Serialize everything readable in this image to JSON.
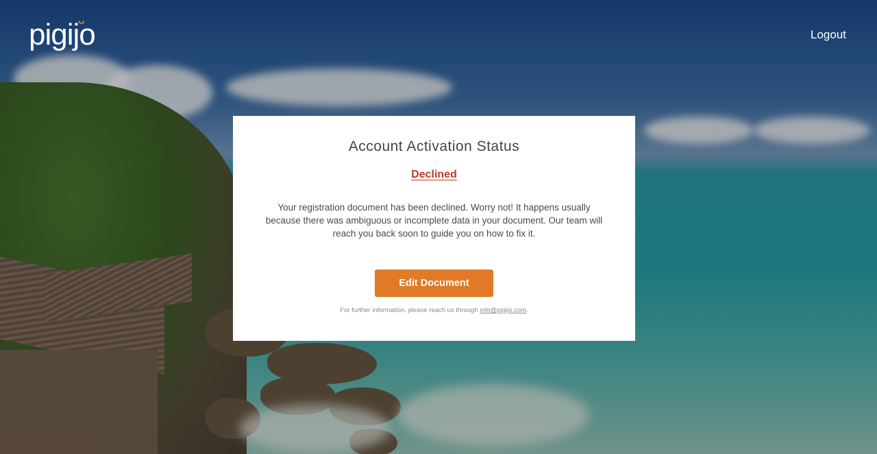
{
  "header": {
    "logo_text": "pigijo",
    "logout_label": "Logout"
  },
  "card": {
    "title": "Account Activation Status",
    "status": "Declined",
    "message": "Your registration document has been declined. Worry not! It happens usually because there was ambiguous or incomplete data in your document. Our team will reach you back soon to guide you on how to fix it.",
    "button_label": "Edit Document",
    "footer_prefix": "For further information, please reach us through ",
    "footer_email": "info@pigijo.com",
    "footer_suffix": "."
  },
  "colors": {
    "accent": "#e07a26",
    "status_declined": "#c0392b"
  }
}
